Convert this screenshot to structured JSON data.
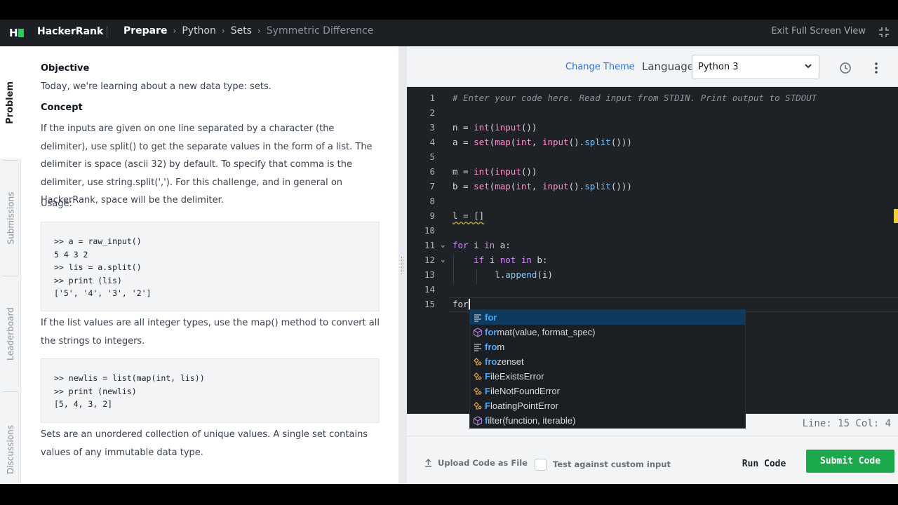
{
  "header": {
    "brand": "HackerRank",
    "crumbs": [
      "Prepare",
      "Python",
      "Sets",
      "Symmetric Difference"
    ],
    "exit_fullscreen": "Exit Full Screen View"
  },
  "sidebar": {
    "tabs": [
      "Problem",
      "Submissions",
      "Leaderboard",
      "Discussions"
    ]
  },
  "problem": {
    "objective_heading": "Objective",
    "objective_text": "Today, we're learning about a new data type: sets.",
    "concept_heading": "Concept",
    "concept_text": "If the inputs are given on one line separated by a character (the delimiter), use split() to get the separate values in the form of a list. The delimiter is space (ascii 32) by default. To specify that comma is the delimiter, use string.split(','). For this challenge, and in general on HackerRank, space will be the delimiter.",
    "usage_label": "Usage:",
    "code1": [
      ">> a = raw_input()",
      "5 4 3 2",
      ">> lis = a.split()",
      ">> print (lis)",
      "['5', '4', '3', '2']"
    ],
    "map_text": "If the list values are all integer types, use the map() method to convert all the strings to integers.",
    "code2": [
      ">> newlis = list(map(int, lis))",
      ">> print (newlis)",
      "[5, 4, 3, 2]"
    ],
    "sets_text": "Sets are an unordered collection of unique values. A single set contains values of any immutable data type."
  },
  "editor_header": {
    "change_theme": "Change Theme",
    "language_label": "Language",
    "language_value": "Python 3"
  },
  "editor": {
    "line_numbers": [
      "1",
      "2",
      "3",
      "4",
      "5",
      "6",
      "7",
      "8",
      "9",
      "10",
      "11",
      "12",
      "13",
      "14",
      "15"
    ],
    "line1_comment": "# Enter your code here. Read input from STDIN. Print output to STDOUT",
    "typed": "for"
  },
  "autocomplete": {
    "items": [
      {
        "match": "for",
        "rest": "",
        "icon": "keyword-icon"
      },
      {
        "match": "for",
        "rest": "mat(value, format_spec)",
        "icon": "function-icon"
      },
      {
        "match": "fro",
        "rest": "m",
        "icon": "keyword-icon"
      },
      {
        "match": "fro",
        "rest": "zenset",
        "icon": "class-icon"
      },
      {
        "match": "F",
        "rest": "ileExistsError",
        "icon": "class-icon"
      },
      {
        "match": "F",
        "rest": "ileNotFoundError",
        "icon": "class-icon"
      },
      {
        "match": "F",
        "rest": "loatingPointError",
        "icon": "class-icon"
      },
      {
        "match": "f",
        "rest": "ilter(function, iterable)",
        "icon": "function-icon"
      }
    ]
  },
  "status": {
    "position": "Line: 15 Col: 4"
  },
  "bottom": {
    "upload": "Upload Code as File",
    "custom_input": "Test against custom input",
    "run": "Run Code",
    "submit": "Submit Code"
  }
}
